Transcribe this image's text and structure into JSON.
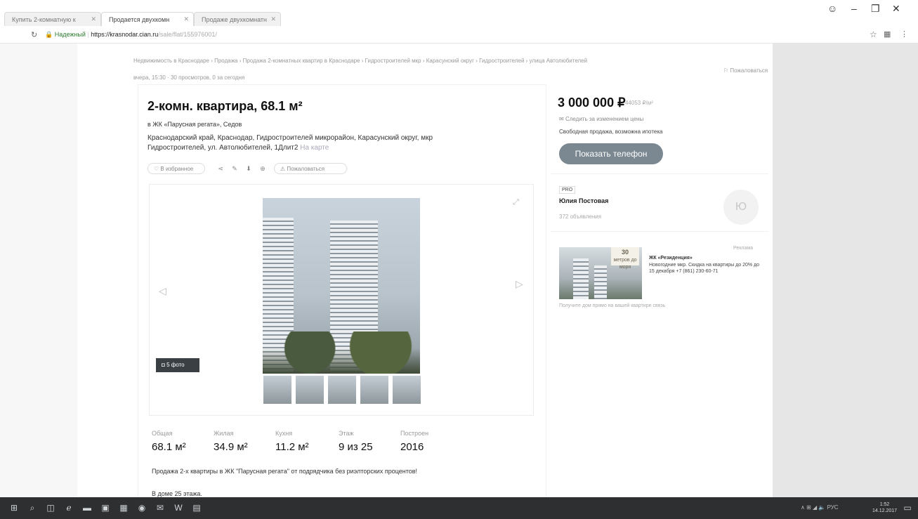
{
  "browser": {
    "tabs": [
      {
        "label": "Купить 2-комнатную к"
      },
      {
        "label": "Продается двухкомн"
      },
      {
        "label": "Продаже двухкомнатн"
      }
    ],
    "address": {
      "secure_label": "Надежный",
      "host": "https://krasnodar.cian.ru",
      "path": "/sale/flat/155976001/"
    }
  },
  "page": {
    "breadcrumbs": "Недвижимость в Краснодаре › Продажа › Продажа 2-комнатных квартир в Краснодаре › Гидростроителей мкр › Карасунский округ › Гидростроителей › улица Автолюбителей",
    "meta": "вчера, 15:30 · 30 просмотров, 0 за сегодня",
    "complain": "Пожаловаться",
    "title": "2-комн. квартира, 68.1 м²",
    "complex": "в ЖК «Парусная регата», Седов",
    "address": "Краснодарский край, Краснодар, Гидростроителей микрорайон, Карасунский округ, мкр Гидростроителей, ул. Автолюбителей, 1Длит2",
    "map_link": "На карте",
    "actions": {
      "favorite": "В избранное",
      "complain": "Пожаловаться"
    },
    "photo_count": "5 фото",
    "stats": [
      {
        "label": "Общая",
        "value": "68.1 м²"
      },
      {
        "label": "Жилая",
        "value": "34.9 м²"
      },
      {
        "label": "Кухня",
        "value": "11.2 м²"
      },
      {
        "label": "Этаж",
        "value": "9 из 25"
      },
      {
        "label": "Построен",
        "value": "2016"
      }
    ],
    "description": "Продажа 2-х квартиры в ЖК \"Парусная регата\" от подрядчика без риэлторских процентов!",
    "description2": "В доме 25 этажа."
  },
  "sidebar": {
    "price": "3 000 000 ₽",
    "price_per_m": "44053 ₽/м²",
    "follow_price": "Следить за изменением цены",
    "sale_terms": "Свободная продажа, возможна ипотека",
    "phone_button": "Показать телефон",
    "agent": {
      "tag": "PRO",
      "name": "Юлия Постовая",
      "sub": "372 объявления",
      "initial": "Ю"
    },
    "ad": {
      "label": "Реклама",
      "badge_num": "30",
      "badge_text": "метров до моря",
      "title": "ЖК «Резиденция»",
      "text": "Новогодние мкр. Скидка на квартиры до 20% до 15 декабря +7 (861) 230-60-71",
      "footer": "Получите дом прямо на вашей квартире связь"
    }
  },
  "taskbar": {
    "tray": "∧ ⊞ ◢ 🔈 РУС",
    "time": "1:52",
    "date": "14.12.2017"
  }
}
